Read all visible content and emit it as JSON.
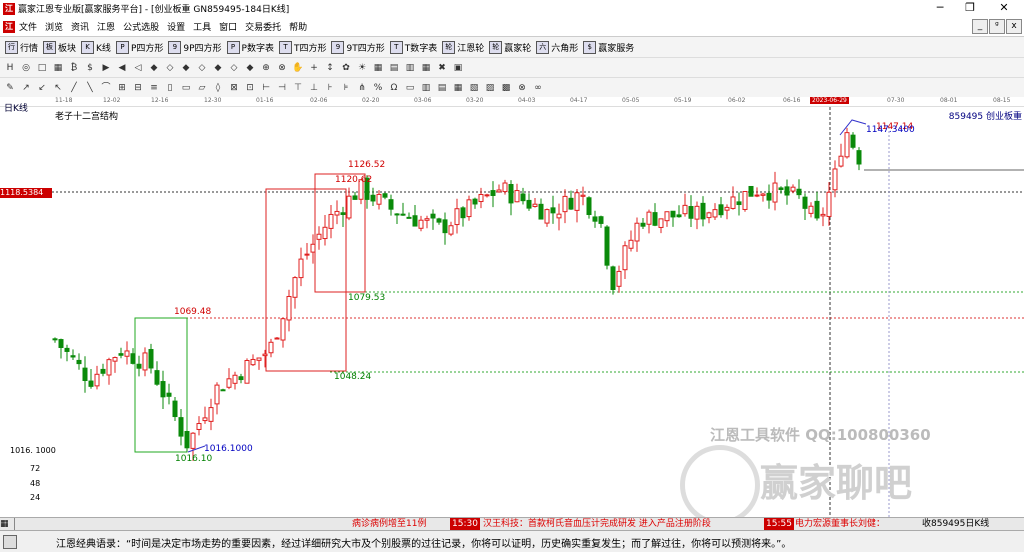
{
  "window": {
    "title": "赢家江恩专业版[赢家服务平台] - [创业板重 GN859495-184日K线]",
    "logo_text": "江"
  },
  "menu": [
    "文件",
    "浏览",
    "资讯",
    "江恩",
    "公式选股",
    "设置",
    "工具",
    "窗口",
    "交易委托",
    "帮助"
  ],
  "toolbar1": [
    {
      "icon": "行",
      "label": "行情"
    },
    {
      "icon": "板",
      "label": "板块"
    },
    {
      "icon": "K",
      "label": "K线"
    },
    {
      "icon": "P",
      "label": "P四方形"
    },
    {
      "icon": "9",
      "label": "9P四方形"
    },
    {
      "icon": "P",
      "label": "P数字表"
    },
    {
      "icon": "T",
      "label": "T四方形"
    },
    {
      "icon": "9",
      "label": "9T四方形"
    },
    {
      "icon": "T",
      "label": "T数字表"
    },
    {
      "icon": "轮",
      "label": "江恩轮"
    },
    {
      "icon": "轮",
      "label": "赢家轮"
    },
    {
      "icon": "六",
      "label": "六角形"
    },
    {
      "icon": "$",
      "label": "赢家服务"
    }
  ],
  "toolbar2_icons": [
    "H",
    "◎",
    "□",
    "▦",
    "₿",
    "$",
    "▶",
    "◀",
    "◁",
    "◆",
    "◇",
    "◆",
    "◇",
    "◆",
    "◇",
    "◆",
    "⊕",
    "⊗",
    "✋",
    "+",
    "↕",
    "✿",
    "☀",
    "▦",
    "▤",
    "▥",
    "▦",
    "✖",
    "▣"
  ],
  "toolbar3_icons": [
    "✎",
    "↗",
    "↙",
    "↖",
    "╱",
    "╲",
    "⌒",
    "⊞",
    "⊟",
    "≡",
    "▯",
    "▭",
    "▱",
    "◊",
    "⊠",
    "⊡",
    "⊢",
    "⊣",
    "⊤",
    "⊥",
    "⊦",
    "⊧",
    "⋔",
    "%",
    "Ω",
    "▭",
    "▥",
    "▤",
    "▦",
    "▧",
    "▨",
    "▩",
    "⊗",
    "∞"
  ],
  "date_ticks": [
    "11-18",
    "12-02",
    "12-16",
    "12-30",
    "01-16",
    "02-06",
    "02-20",
    "03-06",
    "03-20",
    "04-03",
    "04-17",
    "05-05",
    "05-19",
    "06-02",
    "06-16",
    "2023-06-29",
    "07-30",
    "08-01",
    "08-15"
  ],
  "chart_header": {
    "period": "日K线",
    "indicator": "老子十二宫结构",
    "code": "859495 创业板重",
    "current_price": "1118.5384",
    "y_bottom_label": "1016. 1000",
    "volume_ticks": [
      "72",
      "48",
      "24"
    ]
  },
  "chart_data": {
    "type": "candlestick",
    "annotations": [
      {
        "text": "1126.52",
        "color": "#d00000"
      },
      {
        "text": "1120.62",
        "color": "#d00000"
      },
      {
        "text": "1079.53",
        "color": "#008000"
      },
      {
        "text": "1069.48",
        "color": "#d00000"
      },
      {
        "text": "1048.24",
        "color": "#008000"
      },
      {
        "text": "1016.10",
        "color": "#008000"
      },
      {
        "text": "1016.1000",
        "color": "#0000c0"
      },
      {
        "text": "1147.14",
        "color": "#d00000"
      },
      {
        "text": "1147.3400",
        "color": "#0000c0"
      }
    ]
  },
  "watermark": {
    "line1": "江恩工具软件 QQ:100800360",
    "line2": "赢家聊吧"
  },
  "status": {
    "s1": "病诊病例增至11例",
    "s2_time": "15:30",
    "s2": "汉王科技：首款柯氏音血压计完成研发 进入产品注册阶段",
    "s3_time": "15:55",
    "s3": "电力宏源董事长刘健：",
    "s4": "收859495日K线"
  },
  "quote": "江恩经典语录：“时间是决定市场走势的重要因素，经过详细研究大市及个别股票的过往记录，你将可以证明，历史确实重复发生；而了解过往，你将可以预测将来。”。"
}
